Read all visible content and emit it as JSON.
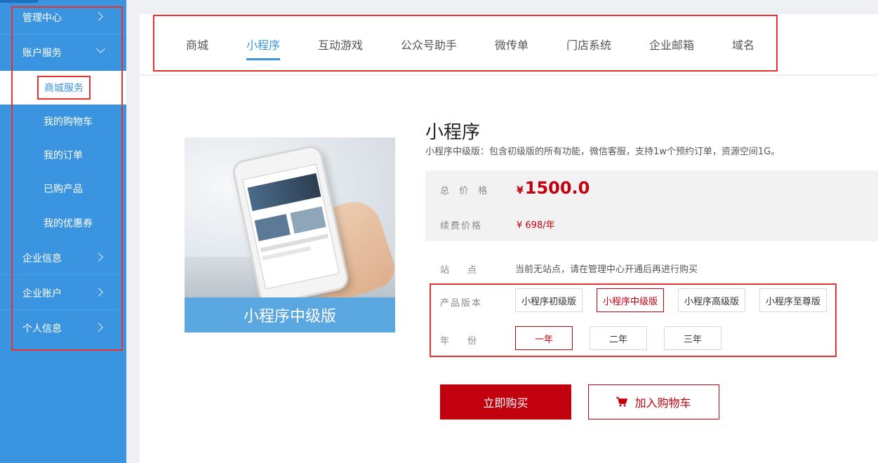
{
  "sidebar": {
    "items": [
      {
        "label": "管理中心"
      },
      {
        "label": "账户服务"
      },
      {
        "label": "企业信息"
      },
      {
        "label": "企业账户"
      },
      {
        "label": "个人信息"
      }
    ],
    "sub_items": [
      {
        "label": "商城服务"
      },
      {
        "label": "我的购物车"
      },
      {
        "label": "我的订单"
      },
      {
        "label": "已购产品"
      },
      {
        "label": "我的优惠券"
      }
    ]
  },
  "tabs": [
    {
      "label": "商城"
    },
    {
      "label": "小程序"
    },
    {
      "label": "互动游戏"
    },
    {
      "label": "公众号助手"
    },
    {
      "label": "微传单"
    },
    {
      "label": "门店系统"
    },
    {
      "label": "企业邮箱"
    },
    {
      "label": "域名"
    }
  ],
  "product": {
    "image_caption": "小程序中级版",
    "title": "小程序",
    "description": "小程序中级版：包含初级版的所有功能，微信客服，支持1w个预约订单，资源空间1G。",
    "total_price_label": "总 价 格",
    "currency": "¥",
    "total_price": "1500.0",
    "renew_label": "续费价格",
    "renew_price": "¥ 698/年",
    "site_label": "站　　点",
    "site_text": "当前无站点，请在管理中心开通后再进行购买",
    "version_label": "产品版本",
    "versions": [
      "小程序初级版",
      "小程序中级版",
      "小程序高级版",
      "小程序至尊版"
    ],
    "year_label": "年　　份",
    "years": [
      "一年",
      "二年",
      "三年"
    ]
  },
  "actions": {
    "buy_label": "立即购买",
    "cart_label": "加入购物车"
  },
  "colors": {
    "sidebar_bg": "#3a94df",
    "accent": "#3a94df",
    "price_red": "#c3000d",
    "annotation_red": "#e8322e"
  }
}
